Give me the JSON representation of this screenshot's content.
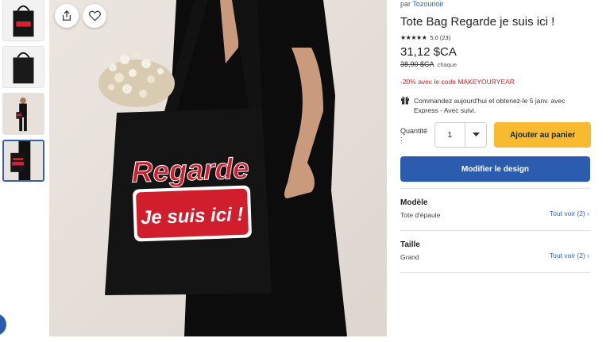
{
  "product": {
    "by_prefix": "par",
    "seller": "Tozounoir",
    "title": "Tote Bag Regarde je suis ici !",
    "stars": "★★★★★",
    "rating": "5.0 (23)",
    "price": "31,12 $CA",
    "old_price": "38,90 $CA",
    "each": "chaque",
    "promo": "-20% avec le code MAKEYOURYEAR",
    "shipping_line1": "Commandez aujourd'hui et obtenez-le 5 janv. avec",
    "shipping_line2": "Express - Avec suivi."
  },
  "bag_text": {
    "line1": "Regarde",
    "line2": "Je suis ici !"
  },
  "purchase": {
    "qty_label": "Quantité :",
    "qty_value": "1",
    "add_to_cart": "Ajouter au panier",
    "modify_design": "Modifier le design"
  },
  "options": [
    {
      "label": "Modèle",
      "value": "Tote d'épaule",
      "see_all": "Tout voir (2)"
    },
    {
      "label": "Taille",
      "value": "Grand",
      "see_all": "Tout voir (2)"
    }
  ],
  "colors": {
    "accent_blue": "#2b5cb0",
    "cart_yellow": "#f8bb2f",
    "promo_red": "#d0202a",
    "link_blue": "#2a62c9"
  },
  "icons": {
    "share": "share-icon",
    "favorite": "heart-icon",
    "gift": "gift-icon",
    "caret": "chevron-down-icon",
    "see_all": "chevron-right-icon"
  }
}
